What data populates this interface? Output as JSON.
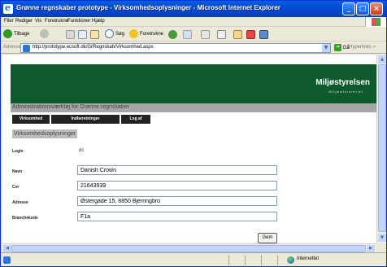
{
  "window": {
    "title": "Grønne regnskaber prototype - Virksomhedsoplysninger - Microsoft Internet Explorer",
    "controls": [
      "_",
      "□",
      "×"
    ]
  },
  "menu": [
    "Filer",
    "Rediger",
    "Vis",
    "Foretrukne",
    "Funktioner",
    "Hjælp"
  ],
  "toolbar": {
    "back": "Tilbage",
    "search": "Søg",
    "favorites": "Foretrukne"
  },
  "address": {
    "label": "Adresse",
    "url": "http://prototype.ecsoft.dk/GrRegnskab/Virksomhed.aspx",
    "go": "Gå",
    "links": "Hyperlinks",
    "links_chevron": "»"
  },
  "page": {
    "brand": "Miljøstyrelsen",
    "brand_sub": "Miljøministeriet",
    "admin_title": "Administrationsværktøj for Grønne regnskaber",
    "nav_tabs": [
      "Virksomhed",
      "Indberetninger",
      "Log af"
    ],
    "section_title": "Virksomhedsoplysninger",
    "login_label": "Login",
    "login_value": "dc",
    "form": {
      "navn_label": "Navn",
      "navn_value": "Danish Crown",
      "cvr_label": "Cvr",
      "cvr_value": "21643939",
      "adresse_label": "Adresse",
      "adresse_value": "Østergade 15, 8850 Bjerringbro",
      "branche_label": "Branchekode",
      "branche_value": "F1a"
    },
    "save_button": "Gem"
  },
  "status": {
    "zone": "Internettet"
  },
  "colors": {
    "banner": "#0e5a2c",
    "titlebar": "#0450d7",
    "nav_tab": "#222222"
  },
  "icons": [
    "ie-logo-icon",
    "back-icon",
    "forward-icon",
    "stop-icon",
    "refresh-icon",
    "home-icon",
    "search-icon",
    "favorites-star-icon",
    "media-icon",
    "history-icon",
    "mail-icon",
    "print-icon",
    "edit-icon",
    "page-icon",
    "go-arrow-icon",
    "internet-zone-icon"
  ]
}
